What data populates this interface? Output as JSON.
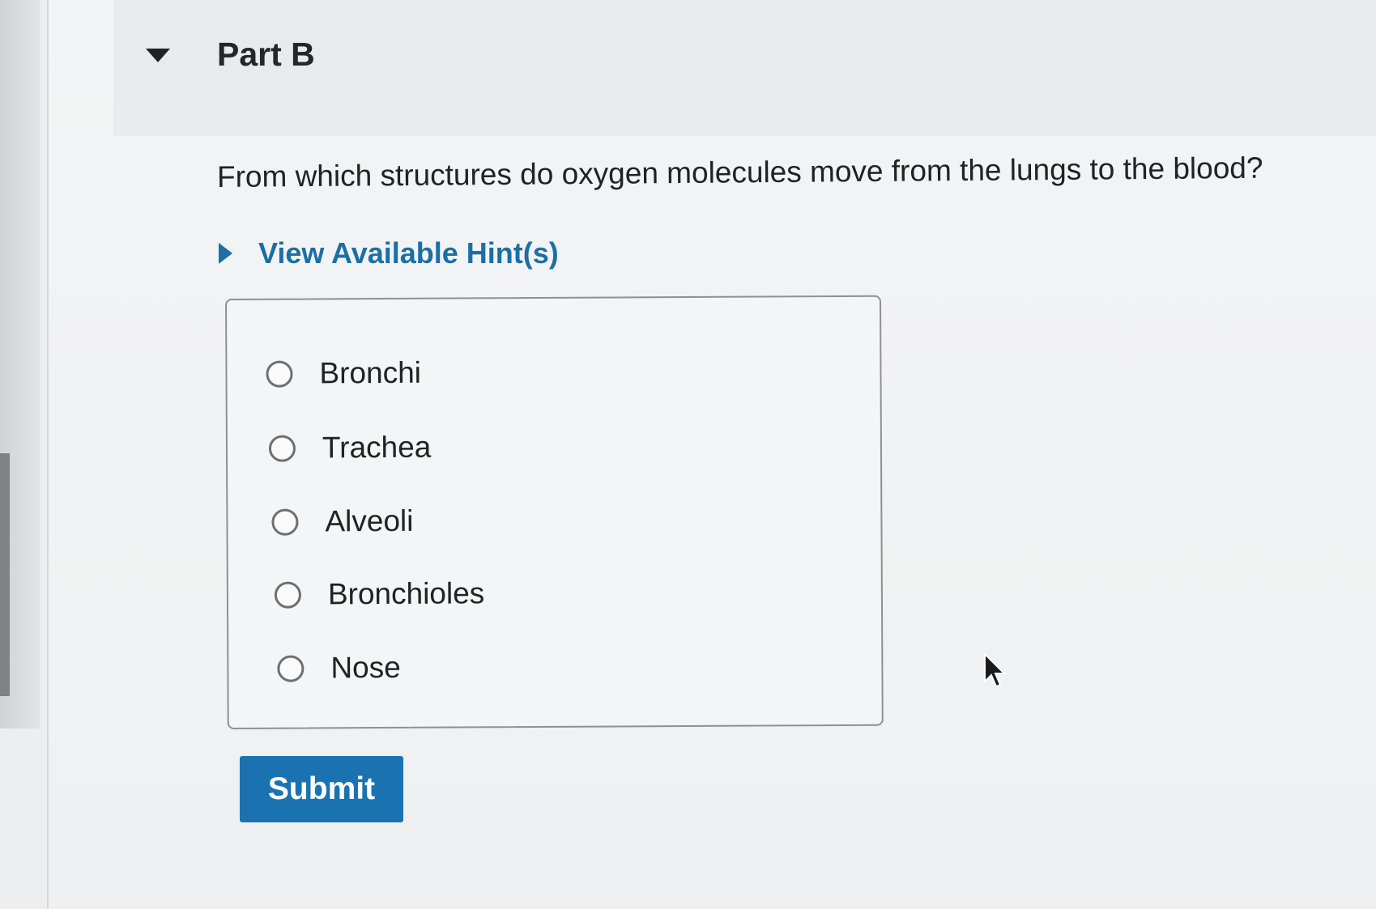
{
  "part": {
    "title": "Part B"
  },
  "question": {
    "text": "From which structures do oxygen molecules move from the lungs to the blood?"
  },
  "hints": {
    "label": "View Available Hint(s)"
  },
  "choices": [
    {
      "label": "Bronchi",
      "selected": false
    },
    {
      "label": "Trachea",
      "selected": false
    },
    {
      "label": "Alveoli",
      "selected": false
    },
    {
      "label": "Bronchioles",
      "selected": false
    },
    {
      "label": "Nose",
      "selected": false
    }
  ],
  "submit": {
    "label": "Submit"
  },
  "colors": {
    "accent": "#1a73b0",
    "link": "#1b6fa3"
  }
}
